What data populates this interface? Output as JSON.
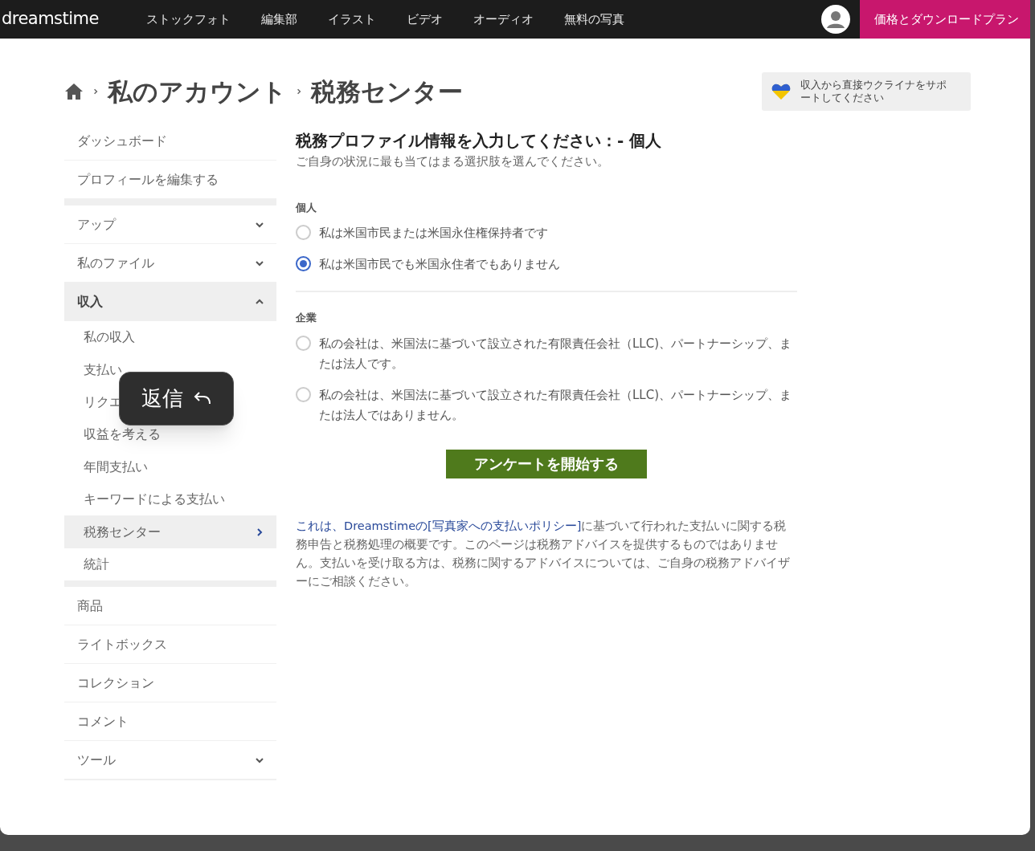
{
  "nav": {
    "logo": "dreamstime",
    "links": [
      "ストックフォト",
      "編集部",
      "イラスト",
      "ビデオ",
      "オーディオ",
      "無料の写真"
    ],
    "cta": "価格とダウンロードプラン"
  },
  "breadcrumb": [
    "私のアカウント",
    "税務センター"
  ],
  "ukraine_banner": "収入から直接ウクライナをサポートしてください",
  "sidebar": {
    "sections": [
      [
        {
          "label": "ダッシュボード",
          "kind": "item"
        },
        {
          "label": "プロフィールを編集する",
          "kind": "item"
        }
      ],
      [
        {
          "label": "アップ",
          "kind": "dropdown",
          "expanded": false
        },
        {
          "label": "私のファイル",
          "kind": "dropdown",
          "expanded": false
        },
        {
          "label": "収入",
          "kind": "dropdown",
          "expanded": true,
          "children": [
            {
              "label": "私の収入",
              "selected": false
            },
            {
              "label": "支払い",
              "selected": false
            },
            {
              "label": "リクエ",
              "selected": false
            },
            {
              "label": "収益を考える",
              "selected": false
            },
            {
              "label": "年間支払い",
              "selected": false
            },
            {
              "label": "キーワードによる支払い",
              "selected": false
            },
            {
              "label": "税務センター",
              "selected": true
            },
            {
              "label": "統計",
              "selected": false
            }
          ]
        }
      ],
      [
        {
          "label": "商品",
          "kind": "item"
        },
        {
          "label": "ライトボックス",
          "kind": "item"
        },
        {
          "label": "コレクション",
          "kind": "item"
        },
        {
          "label": "コメント",
          "kind": "item"
        },
        {
          "label": "ツール",
          "kind": "dropdown",
          "expanded": false
        }
      ]
    ]
  },
  "tooltip": {
    "label": "返信"
  },
  "form": {
    "title": "税務プロファイル情報を入力してください：- 個人",
    "subtitle": "ご自身の状況に最も当てはまる選択肢を選んでください。",
    "groups": [
      {
        "label": "個人",
        "options": [
          {
            "label": "私は米国市民または米国永住権保持者です",
            "selected": false
          },
          {
            "label": "私は米国市民でも米国永住者でもありません",
            "selected": true
          }
        ]
      },
      {
        "label": "企業",
        "options": [
          {
            "label": "私の会社は、米国法に基づいて設立された有限責任会社（LLC)、パートナーシップ、または法人です。",
            "selected": false
          },
          {
            "label": "私の会社は、米国法に基づいて設立された有限責任会社（LLC)、パートナーシップ、または法人ではありません。",
            "selected": false
          }
        ]
      }
    ],
    "button": "アンケートを開始する",
    "note_link": "これは、Dreamstimeの[写真家への支払いポリシー]",
    "note_rest": "に基づいて行われた支払いに関する税務申告と税務処理の概要です。このページは税務アドバイスを提供するものではありません。支払いを受け取る方は、税務に関するアドバイスについては、ご自身の税務アドバイザーにご相談ください。"
  }
}
